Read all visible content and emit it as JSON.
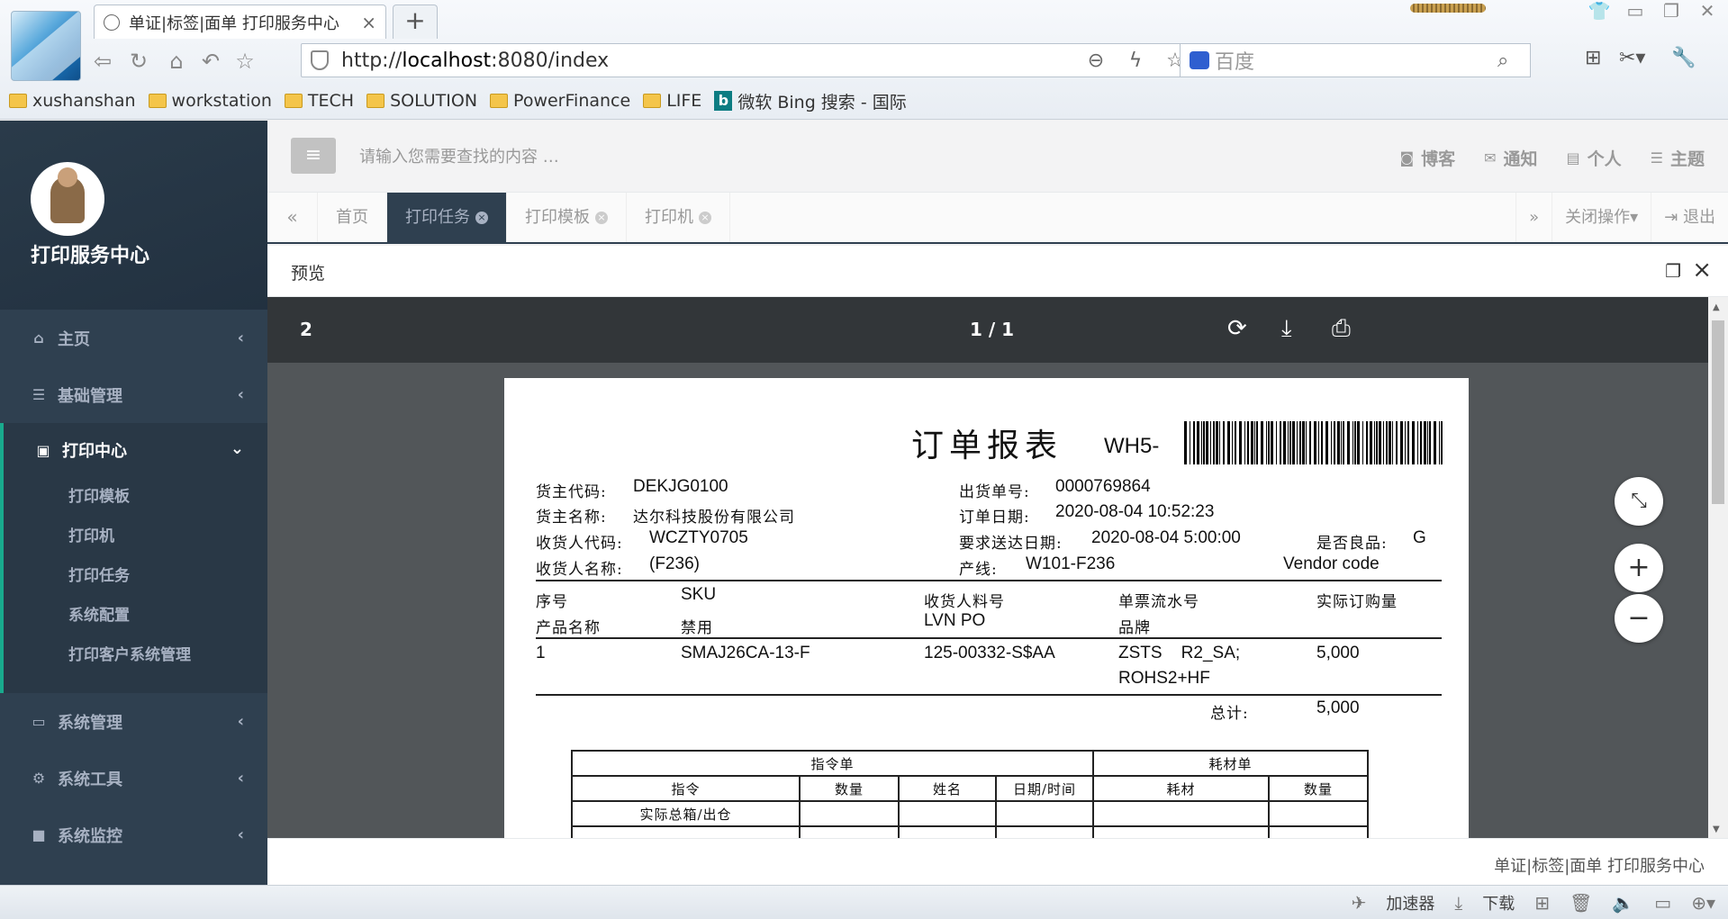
{
  "browser": {
    "tab_title": "单证|标签|面单 打印服务中心",
    "tab_close": "×",
    "new_tab": "+",
    "url_prefix": "http://",
    "url_host": "localhost",
    "url_rest": ":8080/index",
    "search_placeholder": "百度",
    "bookmarks": [
      "xushanshan",
      "workstation",
      "TECH",
      "SOLUTION",
      "PowerFinance",
      "LIFE"
    ],
    "bing_bookmark": "微软 Bing 搜索 - 国际"
  },
  "sidebar": {
    "app_name": "打印服务中心",
    "menu": [
      {
        "label": "主页",
        "icon": "home-icon"
      },
      {
        "label": "基础管理",
        "icon": "list-icon"
      }
    ],
    "print_center": {
      "label": "打印中心",
      "icon": "play-square-icon",
      "items": [
        "打印模板",
        "打印机",
        "打印任务",
        "系统配置",
        "打印客户系统管理"
      ]
    },
    "menu_after": [
      {
        "label": "系统管理",
        "icon": "desktop-icon"
      },
      {
        "label": "系统工具",
        "icon": "gear-icon"
      },
      {
        "label": "系统监控",
        "icon": "video-camera-icon"
      }
    ]
  },
  "topbar": {
    "search_placeholder": "请输入您需要查找的内容 …",
    "links": [
      {
        "label": "博客",
        "icon": "rss-icon",
        "glyph": "◙"
      },
      {
        "label": "通知",
        "icon": "envelope-icon",
        "glyph": "✉"
      },
      {
        "label": "个人",
        "icon": "id-card-icon",
        "glyph": "▤"
      },
      {
        "label": "主题",
        "icon": "tasks-icon",
        "glyph": "☰"
      }
    ]
  },
  "tabs": {
    "items": [
      {
        "label": "首页",
        "active": false,
        "closable": false
      },
      {
        "label": "打印任务",
        "active": true,
        "closable": true
      },
      {
        "label": "打印模板",
        "active": false,
        "closable": true
      },
      {
        "label": "打印机",
        "active": false,
        "closable": true
      }
    ],
    "close_ops": "关闭操作▾",
    "logout": "退出"
  },
  "preview": {
    "title": "预览"
  },
  "pdf": {
    "page_num": "2",
    "page_count": "1 / 1"
  },
  "document": {
    "title": "订单报表",
    "code": "WH5-",
    "fields": {
      "owner_code_label": "货主代码:",
      "owner_code": "DEKJG0100",
      "owner_name_label": "货主名称:",
      "owner_name": "达尔科技股份有限公司",
      "consignee_code_label": "收货人代码:",
      "consignee_code": "WCZTY0705",
      "consignee_name_label": "收货人名称:",
      "consignee_name": "(F236)",
      "shipment_no_label": "出货单号:",
      "shipment_no": "0000769864",
      "order_date_label": "订单日期:",
      "order_date": "2020-08-04  10:52:23",
      "required_date_label": "要求送达日期:",
      "required_date": "2020-08-04  5:00:00",
      "line_label": "产线:",
      "line": "W101-F236",
      "good_label": "是否良品:",
      "good": "G",
      "vendor_code": "Vendor code"
    },
    "item_headers": {
      "seq": "序号",
      "sku": "SKU",
      "consignee_part": "收货人料号",
      "serial": "单票流水号",
      "qty": "实际订购量",
      "product": "产品名称",
      "forbid": "禁用",
      "lvn_po": "LVN PO",
      "brand": "品牌"
    },
    "items": [
      {
        "seq": "1",
        "sku": "SMAJ26CA-13-F",
        "part": "125-00332-S$AA",
        "serial": "ZSTS    R2_SA;",
        "brand": "ROHS2+HF",
        "qty": "5,000"
      }
    ],
    "total_label": "总计:",
    "total": "5,000",
    "cmd_table": {
      "h_cmd": "指令单",
      "h_material": "耗材单",
      "c_cmd": "指令",
      "c_qty": "数量",
      "c_name": "姓名",
      "c_datetime": "日期/时间",
      "c_material": "耗材",
      "c_qty2": "数量",
      "row1": "实际总箱/出仓"
    }
  },
  "footer": {
    "text": "单证|标签|面单 打印服务中心"
  },
  "statusbar": {
    "accelerator": "加速器",
    "download": "下载"
  }
}
